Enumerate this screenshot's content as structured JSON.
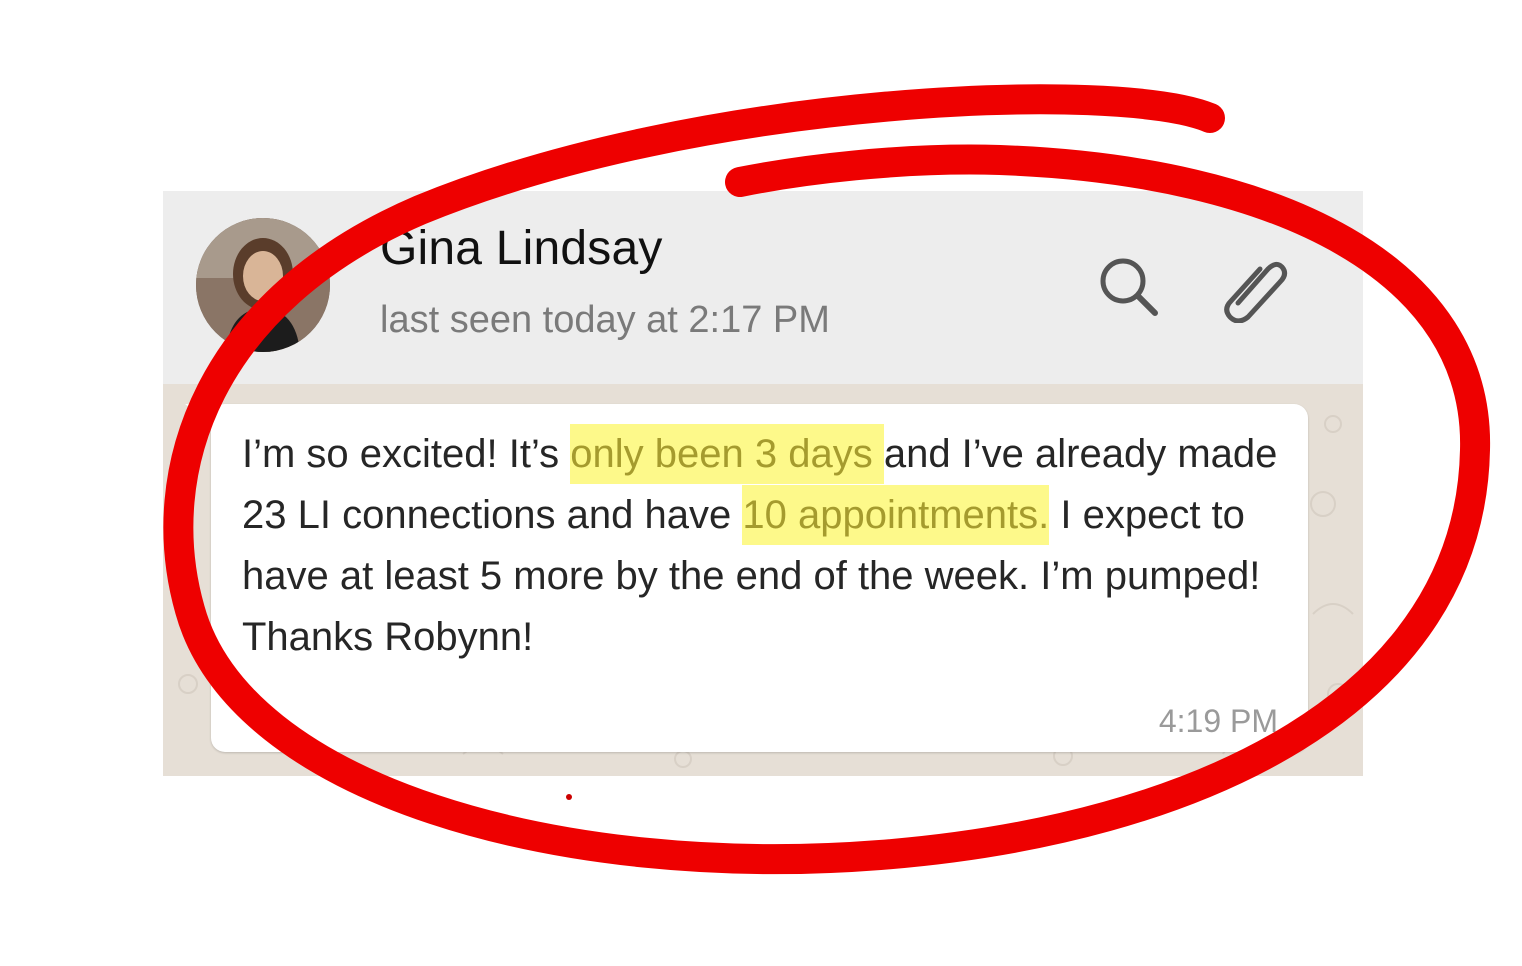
{
  "header": {
    "contact_name": "Gina Lindsay",
    "last_seen": "last seen today at 2:17 PM",
    "icons": {
      "search": "search-icon",
      "attach": "paperclip-icon"
    }
  },
  "message": {
    "segments": [
      {
        "text": "I’m so excited! It’s ",
        "highlight": false
      },
      {
        "text": "only been 3 days ",
        "highlight": true
      },
      {
        "text": "and I’ve already made 23 LI connections and have ",
        "highlight": false
      },
      {
        "text": "10 appointments.",
        "highlight": true
      },
      {
        "text": " I expect to have at least 5 more by the end of the week. I’m pumped! Thanks Robynn!",
        "highlight": false
      }
    ],
    "time": "4:19 PM"
  },
  "colors": {
    "highlight": "#fdf98a",
    "highlight_text": "#a59b2e",
    "annotation_red": "#ee0000",
    "header_bg": "#ededed",
    "chat_bg": "#e6dfd6"
  }
}
